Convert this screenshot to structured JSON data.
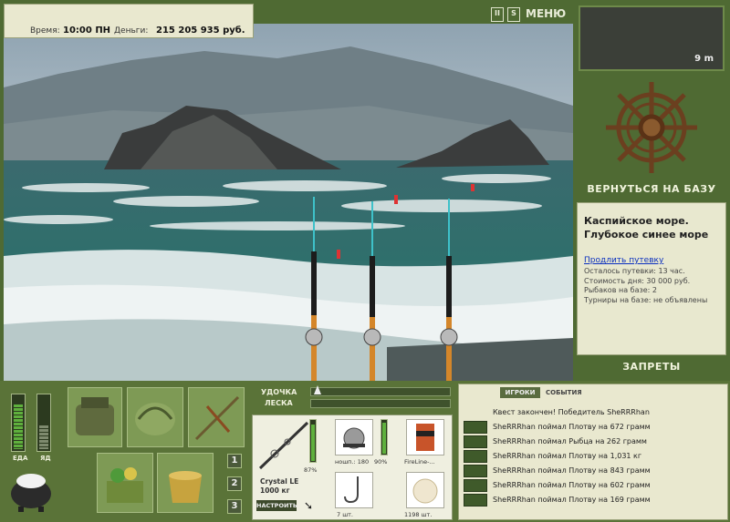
{
  "status": {
    "time_label": "Время:",
    "time_value": "10:00 ПН",
    "money_label": "Деньги:",
    "money_value": "215 205 935 руб."
  },
  "controls": {
    "menu": "МЕНЮ",
    "pause": "II",
    "sound": "S"
  },
  "depth": {
    "value": "9 m"
  },
  "nav": {
    "return_base": "ВЕРНУТЬСЯ НА БАЗУ",
    "bans": "ЗАПРЕТЫ"
  },
  "location": {
    "title": "Каспийское море. Глубокое синее море",
    "extend_link": "Продлить путевку",
    "rows": [
      "Осталось путевки: 13 час.",
      "Стоимость дня: 30 000 руб.",
      "Рыбаков на базе: 2",
      "Турниры на базе: не объявлены"
    ]
  },
  "meters": {
    "food_label": "ЕДА",
    "poison_label": "ЯД",
    "food_level": 0.85,
    "poison_level": 0.45
  },
  "tackle": {
    "rod_label": "УДОЧКА",
    "line_label": "ЛЕСКА",
    "rod_name": "Crystal LE",
    "rod_load": "1000 кг",
    "rod_percent": "87%",
    "setup_button": "НАСТРОИТЬ",
    "reel_caption": "ношп.: 180",
    "reel_percent": "90%",
    "line_caption": "FireLine-...",
    "hook_caption": "7 шт.",
    "bait_caption": "1198 шт."
  },
  "rod_slots": [
    "1",
    "2",
    "3"
  ],
  "events": {
    "tab_players": "ИГРОКИ",
    "tab_events": "СОБЫТИЯ",
    "quest": "Квест закончен! Победитель SheRRRhan",
    "list": [
      "SheRRRhan поймал Плотву на 672 грамм",
      "SheRRRhan поймал Рыбца на 262 грамм",
      "SheRRRhan поймал Плотву на 1,031 кг",
      "SheRRRhan поймал Плотву на 843 грамм",
      "SheRRRhan поймал Плотву на 602 грамм",
      "SheRRRhan поймал Плотву на 169 грамм"
    ]
  }
}
